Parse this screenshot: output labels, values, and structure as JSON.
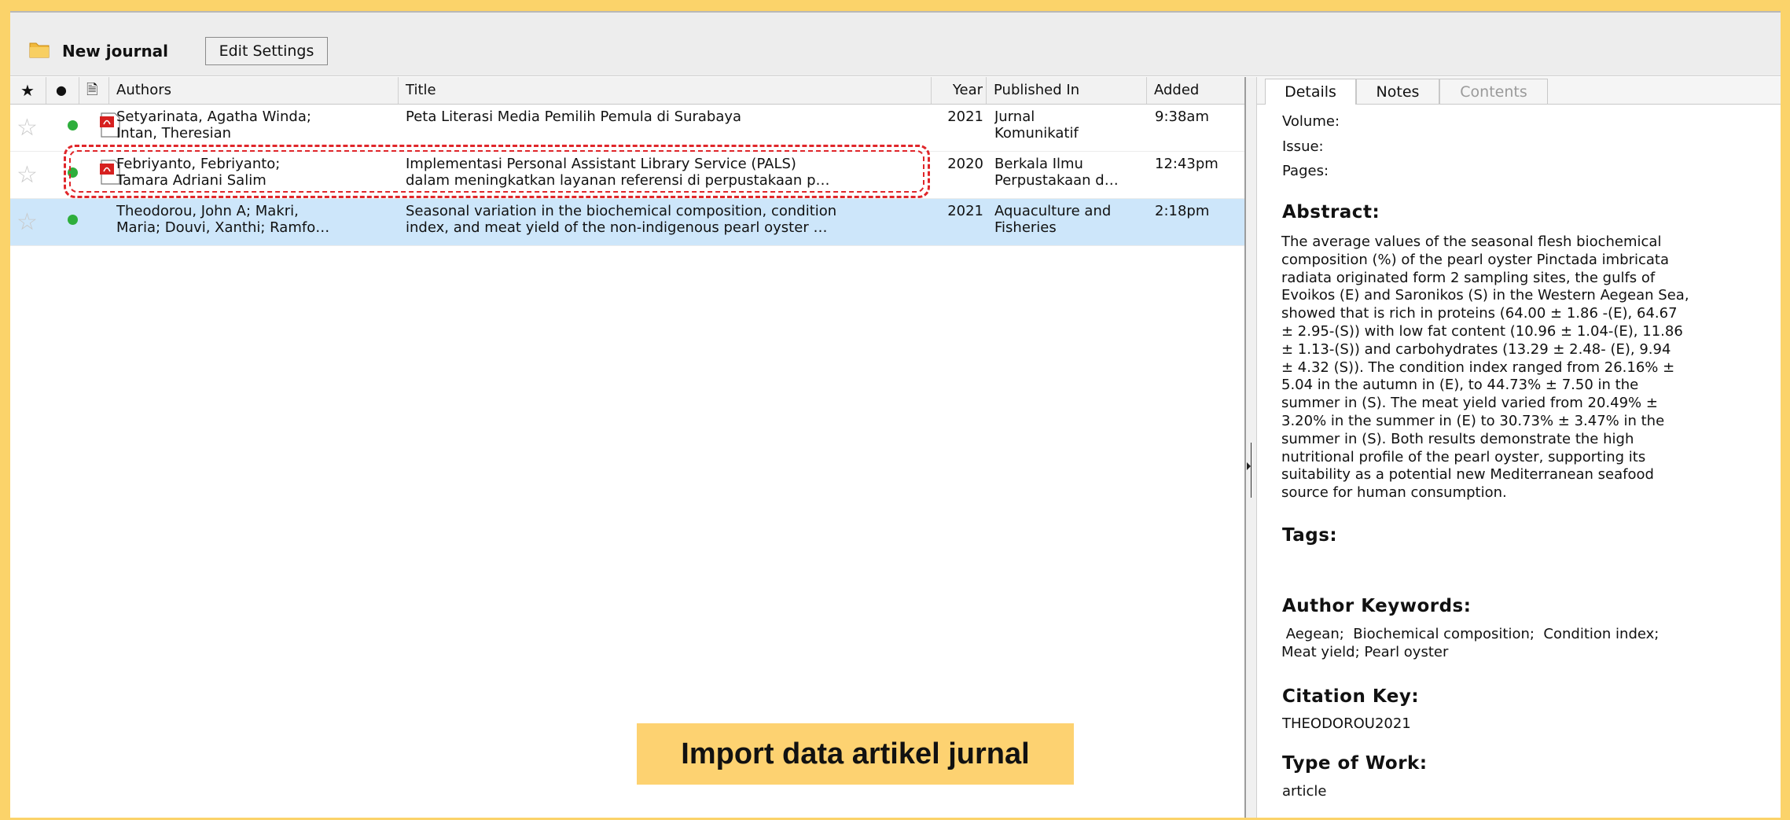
{
  "toolbar": {
    "group_name": "New journal",
    "edit_settings_label": "Edit Settings"
  },
  "list": {
    "columns": {
      "star": "★",
      "read": "●",
      "file": "🗎",
      "authors": "Authors",
      "title": "Title",
      "year": "Year",
      "published_in": "Published In",
      "added": "Added"
    },
    "rows": [
      {
        "authors_1": "Setyarinata, Agatha Winda;",
        "authors_2": "Intan, Theresian",
        "title_1": "Peta Literasi Media Pemilih Pemula di Surabaya",
        "title_2": "",
        "year": "2021",
        "published_1": "Jurnal",
        "published_2": "Komunikatif",
        "added": "9:38am",
        "has_pdf": true,
        "selected": false
      },
      {
        "authors_1": "Febriyanto, Febriyanto;",
        "authors_2": "Tamara Adriani Salim",
        "title_1": "Implementasi Personal Assistant Library Service (PALS)",
        "title_2": "dalam meningkatkan layanan referensi di perpustakaan p…",
        "year": "2020",
        "published_1": "Berkala Ilmu",
        "published_2": "Perpustakaan d…",
        "added": "12:43pm",
        "has_pdf": true,
        "selected": false
      },
      {
        "authors_1": "Theodorou, John A; Makri,",
        "authors_2": "Maria; Douvi, Xanthi; Ramfo…",
        "title_1": "Seasonal variation in the biochemical composition, condition",
        "title_2": "index, and meat yield of the non-indigenous pearl oyster …",
        "year": "2021",
        "published_1": "Aquaculture and",
        "published_2": "Fisheries",
        "added": "2:18pm",
        "has_pdf": false,
        "selected": true
      }
    ]
  },
  "details": {
    "tabs": [
      "Details",
      "Notes",
      "Contents"
    ],
    "volume_label": "Volume:",
    "issue_label": "Issue:",
    "pages_label": "Pages:",
    "abstract_title": "Abstract:",
    "abstract_lines": [
      "The average values of the seasonal flesh biochemical",
      "composition (%) of the pearl oyster Pinctada imbricata",
      "radiata originated form 2 sampling sites, the gulfs of",
      "Evoikos (E) and Saronikos (S) in the Western Aegean Sea,",
      "showed that is rich in proteins (64.00 ± 1.86 -(E), 64.67",
      "± 2.95-(S)) with low fat content (10.96 ± 1.04-(E), 11.86",
      "± 1.13-(S)) and carbohydrates (13.29 ± 2.48- (E), 9.94",
      "± 4.32 (S)). The condition index ranged from 26.16% ±",
      "5.04 in the autumn in (E), to 44.73% ± 7.50 in the",
      "summer in (S). The meat yield varied from 20.49% ±",
      "3.20% in the summer in (E) to 30.73% ± 3.47% in the",
      "summer in (S). Both results demonstrate the high",
      "nutritional profile of the pearl oyster, supporting its",
      "suitability as a potential new Mediterranean seafood",
      "source for human consumption."
    ],
    "tags_title": "Tags:",
    "keywords_title": "Author Keywords:",
    "keywords_line1": " Aegean;  Biochemical composition;  Condition index;",
    "keywords_line2": "Meat yield; Pearl oyster",
    "citation_title": "Citation Key:",
    "citation_value": "THEODOROU2021",
    "type_title": "Type of Work:",
    "type_value": "article"
  },
  "caption": "Import data artikel jurnal",
  "colors": {
    "frame": "#fbd36a",
    "selected_row": "#cde6fa",
    "highlight": "#e0262a",
    "read_dot": "#2eae3c"
  }
}
